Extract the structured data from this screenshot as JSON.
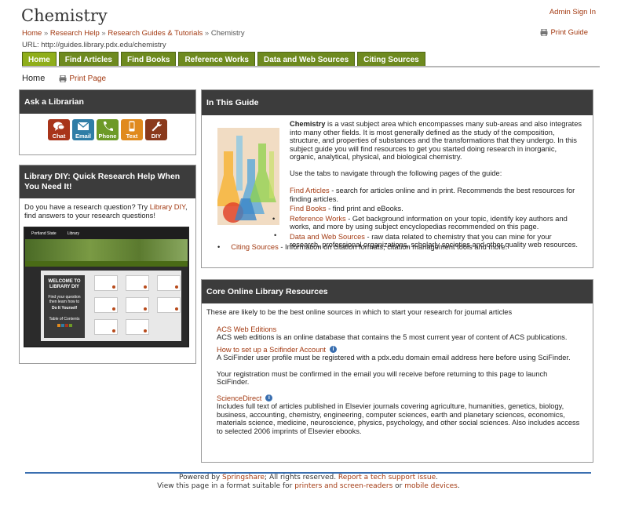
{
  "header": {
    "title": "Chemistry",
    "breadcrumb": [
      "Home",
      "Research Help",
      "Research Guides & Tutorials",
      "Chemistry"
    ],
    "breadcrumb_sep": "»",
    "url_label": "URL: http://guides.library.pdx.edu/chemistry",
    "admin_signin": "Admin Sign In",
    "print_guide": "Print Guide"
  },
  "tabs": [
    {
      "label": "Home",
      "active": true
    },
    {
      "label": "Find Articles",
      "active": false
    },
    {
      "label": "Find Books",
      "active": false
    },
    {
      "label": "Reference Works",
      "active": false
    },
    {
      "label": "Data and Web Sources",
      "active": false
    },
    {
      "label": "Citing Sources",
      "active": false
    }
  ],
  "subnav": {
    "home": "Home",
    "print_page": "Print Page"
  },
  "ask_librarian": {
    "title": "Ask a Librarian",
    "buttons": [
      {
        "label": "Chat",
        "color": "#a8341a",
        "icon": "chat-icon"
      },
      {
        "label": "Email",
        "color": "#2f7da6",
        "icon": "email-icon"
      },
      {
        "label": "Phone",
        "color": "#6d9a27",
        "icon": "phone-icon"
      },
      {
        "label": "Text",
        "color": "#e08a1e",
        "icon": "text-icon"
      },
      {
        "label": "DIY",
        "color": "#8a3a1c",
        "icon": "wrench-icon"
      }
    ]
  },
  "diy": {
    "title": "Library DIY: Quick Research Help When You Need It!",
    "text_before": "Do you have a research question? Try ",
    "link": "Library DIY",
    "text_after": ", find answers to your research questions!",
    "screenshot": {
      "logo": "Portland State",
      "library": "Library",
      "welcome": "WELCOME TO LIBRARY DIY",
      "tagline": "Find your question then learn how to",
      "doit": "Do It Yourself",
      "toc": "Table of Contents"
    }
  },
  "in_this_guide": {
    "title": "In This Guide",
    "intro_bold": "Chemistry",
    "intro": " is a vast subject area which encompasses many sub-areas and also integrates into many other fields. It is most generally defined as the study of the composition, structure, and properties of substances and the transformations that they undergo. In this subject guide you will find resources to get you started doing research in inorganic, organic, analytical, physical, and biological chemistry.",
    "instruction": "Use the tabs to navigate through the following pages of the guide:",
    "items": [
      {
        "link": "Find Articles",
        "desc": " - search for articles online and in print. Recommends the best resources for finding articles."
      },
      {
        "link": "Find Books",
        "desc": " - find print and eBooks."
      },
      {
        "link": "Reference Works",
        "desc": " - Get background information on your topic, identify key authors and works, and more by using subject encyclopedias recommended on this page."
      },
      {
        "link": "Data and Web Sources",
        "desc": " - raw data related to chemistry that you can mine for your research, professional organizations, scholarly societies and other quality web resources."
      }
    ],
    "citing": {
      "link": "Citing Sources",
      "desc": " - Information on citation formats, citation management tools and more."
    }
  },
  "core": {
    "title": "Core Online Library Resources",
    "intro": "These are likely to be the best online sources in which to start your research for journal articles",
    "resources": [
      {
        "name": "ACS Web Editions",
        "info": false,
        "desc": "ACS web editions is an online database that contains the 5 most current year of content of ACS publications."
      },
      {
        "name": "How to set up a Scifinder Account",
        "info": true,
        "desc": "A SciFinder user profile must be registered with a pdx.edu domain email address here before using SciFinder.",
        "desc2": "Your registration must be confirmed in the email you will receive before returning to this page to launch SciFinder."
      },
      {
        "name": "ScienceDirect",
        "info": true,
        "desc": "Includes full text of articles published in Elsevier journals covering agriculture, humanities, genetics, biology, business, accounting, chemistry, engineering, computer sciences, earth and planetary sciences, economics, materials science, medicine, neuroscience, physics, psychology, and other social sciences. Also includes access to selected 2006 imprints of Elsevier ebooks."
      }
    ]
  },
  "footer": {
    "powered": "Powered by ",
    "springshare": "Springshare",
    "rights": "; All rights reserved. ",
    "report": "Report a tech support issue",
    "period": ".",
    "view": "View this page in a format suitable for ",
    "printers": "printers and screen-readers",
    "or": " or ",
    "mobile": "mobile devices",
    "end": "."
  }
}
